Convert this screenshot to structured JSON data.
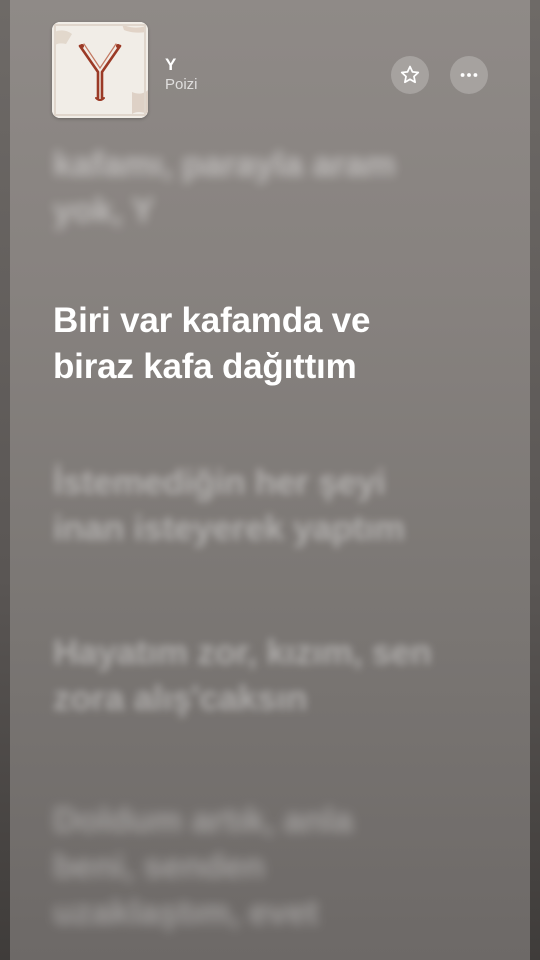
{
  "now_playing": {
    "title": "Y",
    "artist": "Poizi",
    "artwork_letter": "Y"
  },
  "actions": {
    "favorite_icon": "star-icon",
    "more_icon": "ellipsis-icon"
  },
  "lyrics": {
    "previous": [
      "kafamı, parayla aram",
      "yok, Y"
    ],
    "current": [
      "Biri var kafamda ve",
      "biraz kafa dağıttım"
    ],
    "next_1": [
      "İstemediğin her şeyi",
      "inan isteyerek yaptım"
    ],
    "next_2": [
      "Hayatım zor, kızım, sen",
      "zora alış'caksın"
    ],
    "next_3": [
      "Doldum artık, anla",
      "beni, senden",
      "uzaklaştım, evet"
    ]
  },
  "colors": {
    "background": "#8a8582",
    "current_lyric": "#ffffff",
    "artwork_ink": "#9b3a26"
  }
}
